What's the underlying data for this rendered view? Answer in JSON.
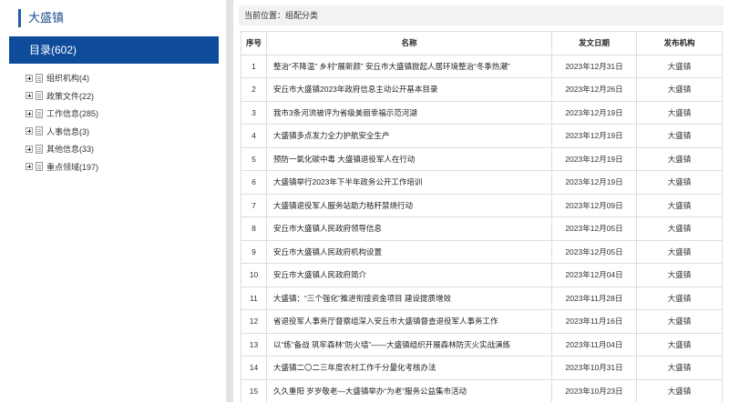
{
  "sidebar": {
    "title": "大盛镇",
    "catalog_label": "目录(602)",
    "items": [
      {
        "label": "组织机构(4)"
      },
      {
        "label": "政策文件(22)"
      },
      {
        "label": "工作信息(285)"
      },
      {
        "label": "人事信息(3)"
      },
      {
        "label": "其他信息(33)"
      },
      {
        "label": "重点领域(197)"
      }
    ]
  },
  "breadcrumb": "当前位置：组配分类",
  "table": {
    "headers": [
      "序号",
      "名称",
      "发文日期",
      "发布机构"
    ],
    "rows": [
      {
        "no": "1",
        "name": "整治“不降温” 乡村“展新颜” 安丘市大盛镇掀起人居环境整治“冬季热潮”",
        "date": "2023年12月31日",
        "org": "大盛镇"
      },
      {
        "no": "2",
        "name": "安丘市大盛镇2023年政府信息主动公开基本目录",
        "date": "2023年12月26日",
        "org": "大盛镇"
      },
      {
        "no": "3",
        "name": "我市3条河流被评为省级美丽幸福示范河湖",
        "date": "2023年12月19日",
        "org": "大盛镇"
      },
      {
        "no": "4",
        "name": "大盛镇多点发力全力护航安全生产",
        "date": "2023年12月19日",
        "org": "大盛镇"
      },
      {
        "no": "5",
        "name": "预防一氧化碳中毒 大盛镇退役军人在行动",
        "date": "2023年12月19日",
        "org": "大盛镇"
      },
      {
        "no": "6",
        "name": "大盛镇举行2023年下半年政务公开工作培训",
        "date": "2023年12月19日",
        "org": "大盛镇"
      },
      {
        "no": "7",
        "name": "大盛镇退役军人服务站助力秸秆禁烧行动",
        "date": "2023年12月09日",
        "org": "大盛镇"
      },
      {
        "no": "8",
        "name": "安丘市大盛镇人民政府领导信息",
        "date": "2023年12月05日",
        "org": "大盛镇"
      },
      {
        "no": "9",
        "name": "安丘市大盛镇人民政府机构设置",
        "date": "2023年12月05日",
        "org": "大盛镇"
      },
      {
        "no": "10",
        "name": "安丘市大盛镇人民政府简介",
        "date": "2023年12月04日",
        "org": "大盛镇"
      },
      {
        "no": "11",
        "name": "大盛镇：“三个强化”推进衔接资金项目 建设提质增效",
        "date": "2023年11月28日",
        "org": "大盛镇"
      },
      {
        "no": "12",
        "name": "省退役军人事务厅督察组深入安丘市大盛镇督查退役军人事务工作",
        "date": "2023年11月16日",
        "org": "大盛镇"
      },
      {
        "no": "13",
        "name": "以“练”备战 筑牢森林“防火墙”——大盛镇组织开展森林防灭火实战演练",
        "date": "2023年11月04日",
        "org": "大盛镇"
      },
      {
        "no": "14",
        "name": "大盛镇二〇二三年度农村工作千分量化考核办法",
        "date": "2023年10月31日",
        "org": "大盛镇"
      },
      {
        "no": "15",
        "name": "久久重阳 岁岁敬老—大盛镇举办“为老”服务公益集市活动",
        "date": "2023年10月23日",
        "org": "大盛镇"
      }
    ]
  }
}
